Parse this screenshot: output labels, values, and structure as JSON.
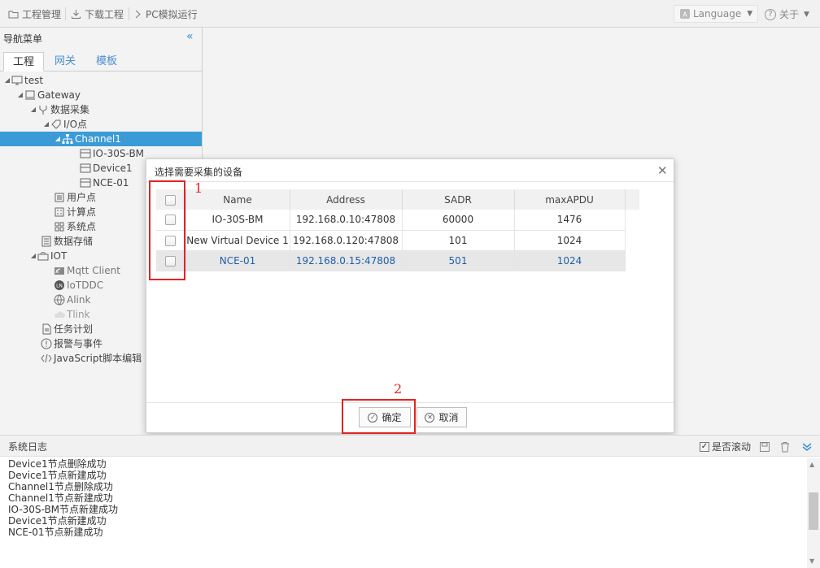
{
  "toolbar": {
    "items": [
      {
        "label": "工程管理",
        "icon": "folder-icon"
      },
      {
        "label": "下载工程",
        "icon": "download-icon"
      },
      {
        "label": "PC模拟运行",
        "icon": "play-icon"
      }
    ],
    "language": "Language",
    "about": "关于"
  },
  "sidebar": {
    "title": "导航菜单",
    "tabs": [
      "工程",
      "网关",
      "模板"
    ],
    "tree": [
      {
        "label": "test",
        "icon": "monitor-icon"
      },
      {
        "label": "Gateway",
        "icon": "gateway-icon"
      },
      {
        "label": "数据采集",
        "icon": "branch-icon"
      },
      {
        "label": "I/O点",
        "icon": "tag-icon"
      },
      {
        "label": "Channel1",
        "icon": "network-icon"
      },
      {
        "label": "IO-30S-BM",
        "icon": "device-icon"
      },
      {
        "label": "Device1",
        "icon": "device-icon"
      },
      {
        "label": "NCE-01",
        "icon": "device-icon"
      },
      {
        "label": "用户点",
        "icon": "list-icon"
      },
      {
        "label": "计算点",
        "icon": "calc-icon"
      },
      {
        "label": "系统点",
        "icon": "grid-icon"
      },
      {
        "label": "数据存储",
        "icon": "database-icon"
      },
      {
        "label": "IOT",
        "icon": "iot-icon"
      },
      {
        "label": "Mqtt Client",
        "icon": "mqtt-icon"
      },
      {
        "label": "IoTDDC",
        "icon": "iotddc-icon"
      },
      {
        "label": "Alink",
        "icon": "globe-icon"
      },
      {
        "label": "Tlink",
        "icon": "cloud-icon"
      },
      {
        "label": "任务计划",
        "icon": "task-icon"
      },
      {
        "label": "报警与事件",
        "icon": "alert-icon"
      },
      {
        "label": "JavaScript脚本编辑",
        "icon": "code-icon"
      }
    ]
  },
  "dialog": {
    "title": "选择需要采集的设备",
    "columns": [
      "Name",
      "Address",
      "SADR",
      "maxAPDU"
    ],
    "rows": [
      {
        "name": "IO-30S-BM",
        "address": "192.168.0.10:47808",
        "sadr": "60000",
        "maxapdu": "1476"
      },
      {
        "name": "New Virtual Device 1",
        "address": "192.168.0.120:47808",
        "sadr": "101",
        "maxapdu": "1024"
      },
      {
        "name": "NCE-01",
        "address": "192.168.0.15:47808",
        "sadr": "501",
        "maxapdu": "1024"
      }
    ],
    "confirm": "确定",
    "cancel": "取消",
    "annotation_1": "1",
    "annotation_2": "2"
  },
  "log": {
    "title": "系统日志",
    "autoscroll": "是否滚动",
    "lines": [
      "Device1节点删除成功",
      "Device1节点新建成功",
      "Channel1节点删除成功",
      "Channel1节点新建成功",
      "IO-30S-BM节点新建成功",
      "Device1节点新建成功",
      "NCE-01节点新建成功"
    ]
  },
  "colors": {
    "accent": "#3b9bd6",
    "annotation": "#e02424"
  }
}
